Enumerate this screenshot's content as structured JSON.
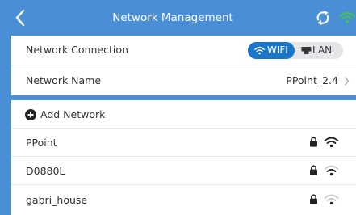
{
  "header": {
    "title": "Network Management",
    "accent_color": "#4a8fd6",
    "back_icon": "chevron-left-icon",
    "refresh_icon": "refresh-icon",
    "status_icon": "wifi-icon",
    "status_icon_color": "#3ec25a"
  },
  "connection": {
    "label": "Network Connection",
    "options": [
      "WIFI",
      "LAN"
    ],
    "selected": "WIFI",
    "selected_color": "#1a76c8"
  },
  "network_name": {
    "label": "Network Name",
    "value": "PPoint_2.4"
  },
  "add_network": {
    "label": "Add Network",
    "icon": "plus-circle-icon"
  },
  "networks": [
    {
      "ssid": "PPoint",
      "secured": true,
      "signal": 3
    },
    {
      "ssid": "D0880L",
      "secured": true,
      "signal": 2
    },
    {
      "ssid": "gabri_house",
      "secured": true,
      "signal": 1
    }
  ]
}
